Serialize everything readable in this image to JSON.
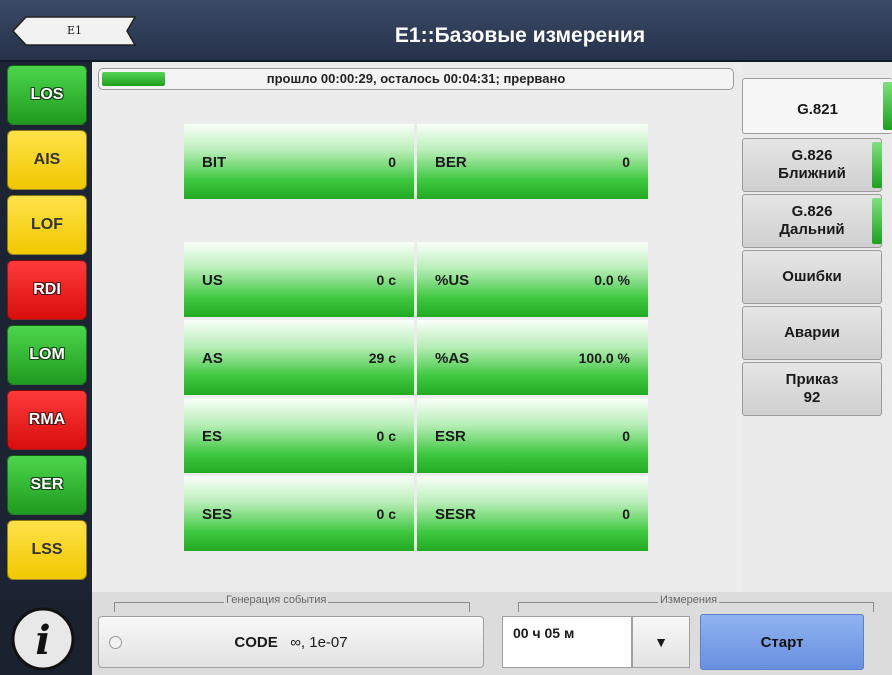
{
  "header": {
    "back_label": "E1",
    "title": "E1::Базовые измерения"
  },
  "alarms": [
    {
      "label": "LOS",
      "color": "green"
    },
    {
      "label": "AIS",
      "color": "yellow"
    },
    {
      "label": "LOF",
      "color": "yellow"
    },
    {
      "label": "RDI",
      "color": "red"
    },
    {
      "label": "LOM",
      "color": "green"
    },
    {
      "label": "RMA",
      "color": "red"
    },
    {
      "label": "SER",
      "color": "green"
    },
    {
      "label": "LSS",
      "color": "yellow"
    }
  ],
  "progress": {
    "text": "прошло 00:00:29, осталось 00:04:31; прервано",
    "fraction": 0.1
  },
  "measurements": {
    "bit": {
      "label": "BIT",
      "value": "0"
    },
    "ber": {
      "label": "BER",
      "value": "0"
    },
    "us": {
      "label": "US",
      "value": "0 c"
    },
    "pus": {
      "label": "%US",
      "value": "0.0 %"
    },
    "as": {
      "label": "AS",
      "value": "29 c"
    },
    "pas": {
      "label": "%AS",
      "value": "100.0 %"
    },
    "es": {
      "label": "ES",
      "value": "0 c"
    },
    "esr": {
      "label": "ESR",
      "value": "0"
    },
    "ses": {
      "label": "SES",
      "value": "0 c"
    },
    "sesr": {
      "label": "SESR",
      "value": "0"
    }
  },
  "tabs": [
    {
      "label": "G.821",
      "active": true,
      "indicator": true
    },
    {
      "label": "G.826\nБлижний",
      "active": false,
      "indicator": true
    },
    {
      "label": "G.826\nДальний",
      "active": false,
      "indicator": true
    },
    {
      "label": "Ошибки",
      "active": false,
      "indicator": false
    },
    {
      "label": "Аварии",
      "active": false,
      "indicator": false
    },
    {
      "label": "Приказ\n92",
      "active": false,
      "indicator": false
    }
  ],
  "bottom": {
    "event_group_label": "Генерация события",
    "code_label": "CODE",
    "code_params": "∞, 1e-07",
    "measure_group_label": "Измерения",
    "duration": "00 ч 05 м",
    "dropdown_symbol": "▼",
    "start_label": "Старт"
  },
  "colors": {
    "accent_green": "#22aa22",
    "start_blue": "#7a9fe8",
    "header": "#2e3b55"
  }
}
